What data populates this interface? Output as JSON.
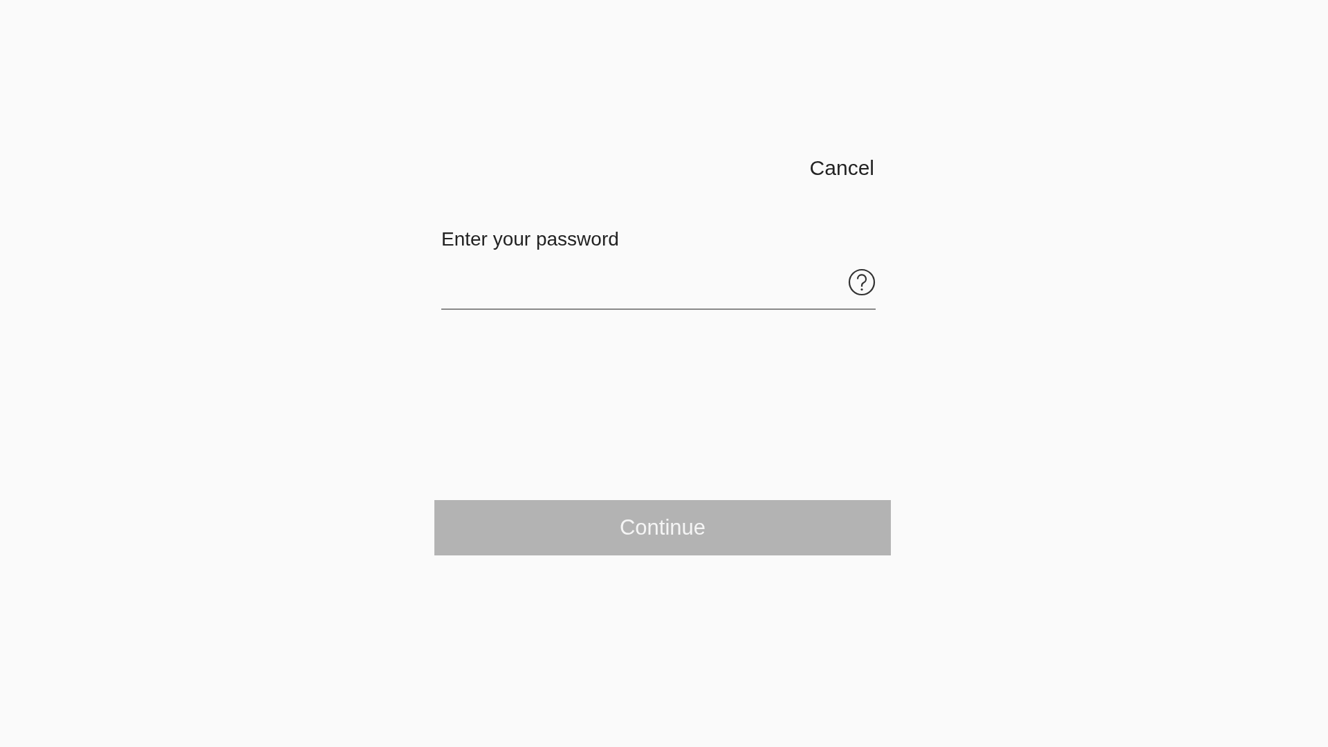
{
  "cancel_link": "Cancel",
  "password_field": {
    "label": "Enter your password"
  },
  "continue_button": {
    "label": "Continue",
    "disabled": true
  }
}
